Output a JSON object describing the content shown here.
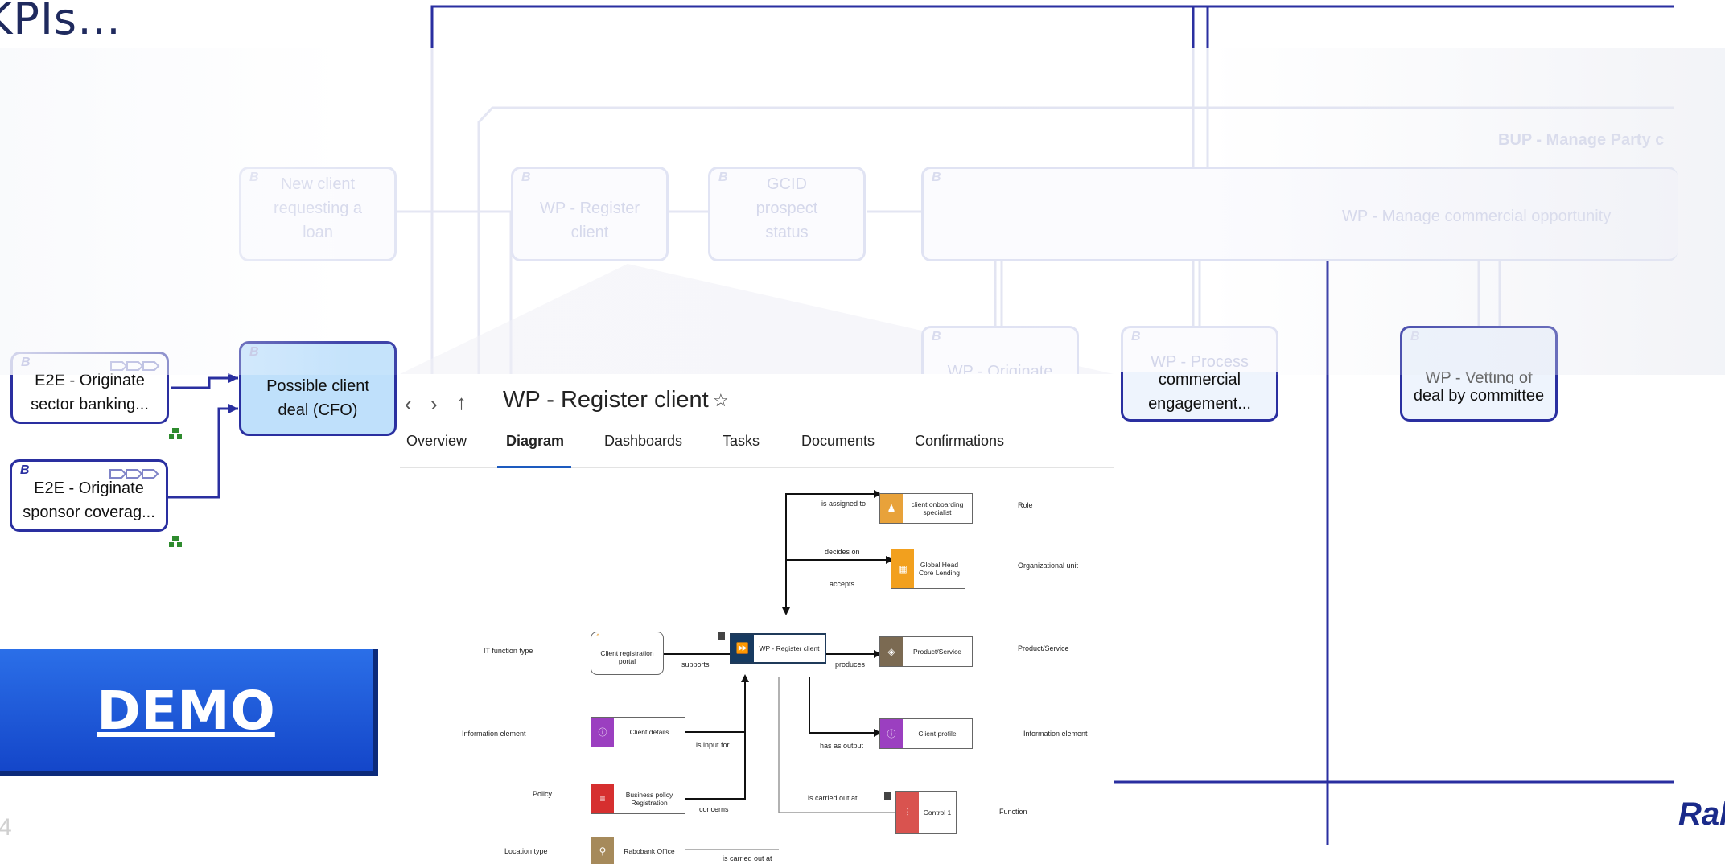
{
  "slide": {
    "title": "KPIs…",
    "page_number": "4",
    "brand": "Ral"
  },
  "background_diagram": {
    "marker": "B",
    "top_right_label": "BUP - Manage Party c",
    "faded_boxes": [
      {
        "label": "New client requesting a loan"
      },
      {
        "label": "WP - Register client"
      },
      {
        "label": "GCID prospect status"
      },
      {
        "label": "WP - Manage commercial opportunity"
      },
      {
        "label": "WP - Originate"
      },
      {
        "label": "WP - Process"
      }
    ],
    "active_boxes": [
      {
        "label_line1": "E2E - Originate",
        "label_line2": "sector banking..."
      },
      {
        "label_line1": "E2E - Originate",
        "label_line2": "sponsor coverag..."
      },
      {
        "label_line1": "Possible client",
        "label_line2": "deal (CFO)"
      },
      {
        "label_line1": "commercial",
        "label_line2": "engagement..."
      },
      {
        "label_line1": "WP - Vetting of",
        "label_line2": "deal by committee"
      }
    ]
  },
  "demo_button": {
    "label": "DEMO"
  },
  "popup": {
    "title": "WP - Register client",
    "tabs": [
      "Overview",
      "Diagram",
      "Dashboards",
      "Tasks",
      "Documents",
      "Confirmations"
    ],
    "active_tab": "Diagram",
    "diagram": {
      "center": "WP - Register client",
      "nodes": [
        {
          "label": "client onboarding specialist",
          "type_label": "Role",
          "relation": "is assigned to",
          "color": "#e8a23a"
        },
        {
          "label": "Global Head Core Lending",
          "type_label": "Organizational unit",
          "relation": "decides on",
          "relation2": "accepts",
          "color": "#f2a01e"
        },
        {
          "label": "Product/Service",
          "type_label": "Product/Service",
          "relation": "produces",
          "color": "#7b6a52"
        },
        {
          "label": "Client profile",
          "type_label": "Information element",
          "relation": "has as output",
          "color": "#9b3fc0"
        },
        {
          "label": "Control 1",
          "type_label": "Function",
          "relation": "is carried out at",
          "color": "#d9534f"
        },
        {
          "label": "Client registration portal",
          "type_label": "IT function type",
          "relation": "supports"
        },
        {
          "label": "Client details",
          "type_label": "Information element",
          "relation": "is input for",
          "color": "#9b3fc0"
        },
        {
          "label": "Business policy Registration",
          "type_label": "Policy",
          "relation": "concerns",
          "color": "#d62f2f"
        },
        {
          "label": "Rabobank Office",
          "type_label": "Location type",
          "relation": "is carried out at",
          "color": "#a68a5b"
        }
      ]
    }
  }
}
